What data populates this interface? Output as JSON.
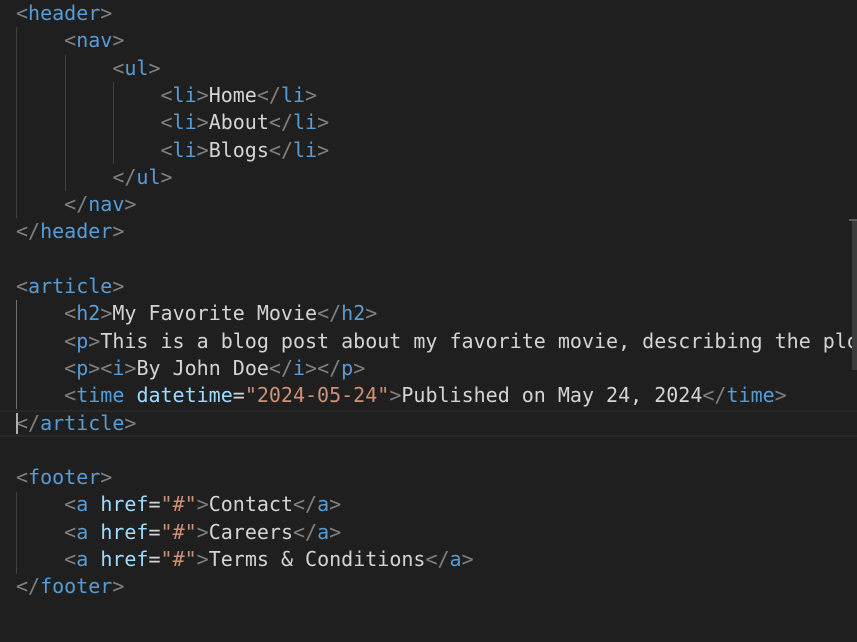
{
  "editor": {
    "language": "html",
    "colors": {
      "background": "#1f1f1f",
      "punctuation": "#808080",
      "tag": "#569cd6",
      "attribute": "#9cdcfe",
      "string": "#ce9178",
      "text": "#d4d4d4"
    },
    "lines": [
      [
        [
          "pun",
          "<"
        ],
        [
          "tag",
          "header"
        ],
        [
          "pun",
          ">"
        ]
      ],
      [
        [
          "lead",
          "    "
        ],
        [
          "pun",
          "<"
        ],
        [
          "tag",
          "nav"
        ],
        [
          "pun",
          ">"
        ]
      ],
      [
        [
          "lead",
          "        "
        ],
        [
          "pun",
          "<"
        ],
        [
          "tag",
          "ul"
        ],
        [
          "pun",
          ">"
        ]
      ],
      [
        [
          "lead",
          "            "
        ],
        [
          "pun",
          "<"
        ],
        [
          "tag",
          "li"
        ],
        [
          "pun",
          ">"
        ],
        [
          "txt",
          "Home"
        ],
        [
          "pun",
          "</"
        ],
        [
          "tag",
          "li"
        ],
        [
          "pun",
          ">"
        ]
      ],
      [
        [
          "lead",
          "            "
        ],
        [
          "pun",
          "<"
        ],
        [
          "tag",
          "li"
        ],
        [
          "pun",
          ">"
        ],
        [
          "txt",
          "About"
        ],
        [
          "pun",
          "</"
        ],
        [
          "tag",
          "li"
        ],
        [
          "pun",
          ">"
        ]
      ],
      [
        [
          "lead",
          "            "
        ],
        [
          "pun",
          "<"
        ],
        [
          "tag",
          "li"
        ],
        [
          "pun",
          ">"
        ],
        [
          "txt",
          "Blogs"
        ],
        [
          "pun",
          "</"
        ],
        [
          "tag",
          "li"
        ],
        [
          "pun",
          ">"
        ]
      ],
      [
        [
          "lead",
          "        "
        ],
        [
          "pun",
          "</"
        ],
        [
          "tag",
          "ul"
        ],
        [
          "pun",
          ">"
        ]
      ],
      [
        [
          "lead",
          "    "
        ],
        [
          "pun",
          "</"
        ],
        [
          "tag",
          "nav"
        ],
        [
          "pun",
          ">"
        ]
      ],
      [
        [
          "pun",
          "</"
        ],
        [
          "tag",
          "header"
        ],
        [
          "pun",
          ">"
        ]
      ],
      [],
      [
        [
          "pun",
          "<"
        ],
        [
          "tag",
          "article"
        ],
        [
          "pun",
          ">"
        ]
      ],
      [
        [
          "lead",
          "    "
        ],
        [
          "pun",
          "<"
        ],
        [
          "tag",
          "h2"
        ],
        [
          "pun",
          ">"
        ],
        [
          "txt",
          "My Favorite Movie"
        ],
        [
          "pun",
          "</"
        ],
        [
          "tag",
          "h2"
        ],
        [
          "pun",
          ">"
        ]
      ],
      [
        [
          "lead",
          "    "
        ],
        [
          "pun",
          "<"
        ],
        [
          "tag",
          "p"
        ],
        [
          "pun",
          ">"
        ],
        [
          "txt",
          "This is a blog post about my favorite movie, describing the plot"
        ]
      ],
      [
        [
          "lead",
          "    "
        ],
        [
          "pun",
          "<"
        ],
        [
          "tag",
          "p"
        ],
        [
          "pun",
          "><"
        ],
        [
          "tag",
          "i"
        ],
        [
          "pun",
          ">"
        ],
        [
          "txt",
          "By John Doe"
        ],
        [
          "pun",
          "</"
        ],
        [
          "tag",
          "i"
        ],
        [
          "pun",
          "></"
        ],
        [
          "tag",
          "p"
        ],
        [
          "pun",
          ">"
        ]
      ],
      [
        [
          "lead",
          "    "
        ],
        [
          "pun",
          "<"
        ],
        [
          "tag",
          "time"
        ],
        [
          "txt",
          " "
        ],
        [
          "attr",
          "datetime"
        ],
        [
          "txt",
          "="
        ],
        [
          "str",
          "\"2024-05-24\""
        ],
        [
          "pun",
          ">"
        ],
        [
          "txt",
          "Published on May 24, 2024"
        ],
        [
          "pun",
          "</"
        ],
        [
          "tag",
          "time"
        ],
        [
          "pun",
          ">"
        ]
      ],
      [
        [
          "pun",
          "</"
        ],
        [
          "tag",
          "article"
        ],
        [
          "pun",
          ">"
        ]
      ],
      [],
      [
        [
          "pun",
          "<"
        ],
        [
          "tag",
          "footer"
        ],
        [
          "pun",
          ">"
        ]
      ],
      [
        [
          "lead",
          "    "
        ],
        [
          "pun",
          "<"
        ],
        [
          "tag",
          "a"
        ],
        [
          "txt",
          " "
        ],
        [
          "attr",
          "href"
        ],
        [
          "txt",
          "="
        ],
        [
          "str",
          "\"#\""
        ],
        [
          "pun",
          ">"
        ],
        [
          "txt",
          "Contact"
        ],
        [
          "pun",
          "</"
        ],
        [
          "tag",
          "a"
        ],
        [
          "pun",
          ">"
        ]
      ],
      [
        [
          "lead",
          "    "
        ],
        [
          "pun",
          "<"
        ],
        [
          "tag",
          "a"
        ],
        [
          "txt",
          " "
        ],
        [
          "attr",
          "href"
        ],
        [
          "txt",
          "="
        ],
        [
          "str",
          "\"#\""
        ],
        [
          "pun",
          ">"
        ],
        [
          "txt",
          "Careers"
        ],
        [
          "pun",
          "</"
        ],
        [
          "tag",
          "a"
        ],
        [
          "pun",
          ">"
        ]
      ],
      [
        [
          "lead",
          "    "
        ],
        [
          "pun",
          "<"
        ],
        [
          "tag",
          "a"
        ],
        [
          "txt",
          " "
        ],
        [
          "attr",
          "href"
        ],
        [
          "txt",
          "="
        ],
        [
          "str",
          "\"#\""
        ],
        [
          "pun",
          ">"
        ],
        [
          "txt",
          "Terms & Conditions"
        ],
        [
          "pun",
          "</"
        ],
        [
          "tag",
          "a"
        ],
        [
          "pun",
          ">"
        ]
      ],
      [
        [
          "pun",
          "</"
        ],
        [
          "tag",
          "footer"
        ],
        [
          "pun",
          ">"
        ]
      ]
    ]
  }
}
